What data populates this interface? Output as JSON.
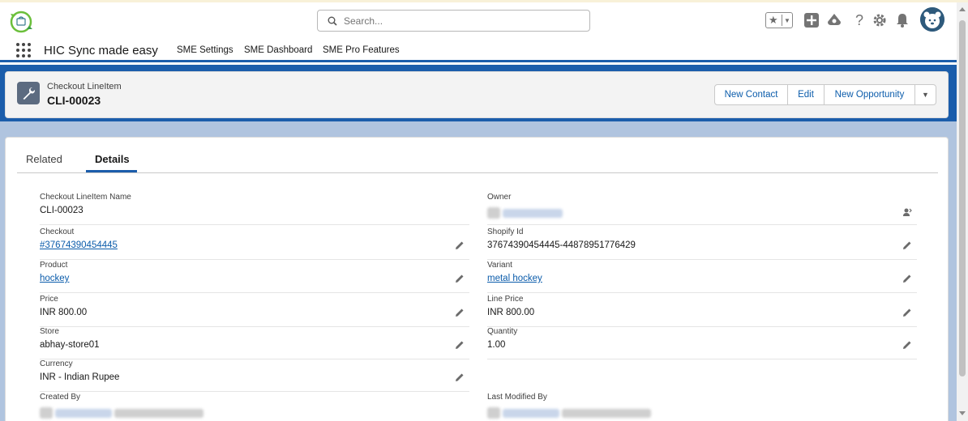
{
  "header": {
    "search_placeholder": "Search...",
    "icons": [
      "favorites-star-icon",
      "global-actions-plus-icon",
      "trailhead-icon",
      "help-icon",
      "setup-gear-icon",
      "notifications-bell-icon",
      "user-avatar"
    ]
  },
  "app": {
    "name": "HIC Sync made easy",
    "nav": [
      "SME Settings",
      "SME Dashboard",
      "SME Pro Features"
    ]
  },
  "record": {
    "object_label": "Checkout LineItem",
    "title": "CLI-00023",
    "actions": {
      "new_contact": "New Contact",
      "edit": "Edit",
      "new_opportunity": "New Opportunity"
    }
  },
  "tabs": [
    "Related",
    "Details"
  ],
  "active_tab": "Details",
  "fields": {
    "name_label": "Checkout LineItem Name",
    "name_value": "CLI-00023",
    "owner_label": "Owner",
    "checkout_label": "Checkout",
    "checkout_value": "#37674390454445",
    "shopify_label": "Shopify Id",
    "shopify_value": "37674390454445-44878951776429",
    "product_label": "Product",
    "product_value": "hockey",
    "variant_label": "Variant",
    "variant_value": "metal hockey",
    "price_label": "Price",
    "price_value": "INR 800.00",
    "line_price_label": "Line Price",
    "line_price_value": "INR 800.00",
    "store_label": "Store",
    "store_value": "abhay-store01",
    "quantity_label": "Quantity",
    "quantity_value": "1.00",
    "currency_label": "Currency",
    "currency_value": "INR - Indian Rupee",
    "created_label": "Created By",
    "modified_label": "Last Modified By"
  },
  "colors": {
    "brand_blue": "#1b5dab",
    "link": "#0b5cab",
    "object_icon": "#5c6b80"
  }
}
